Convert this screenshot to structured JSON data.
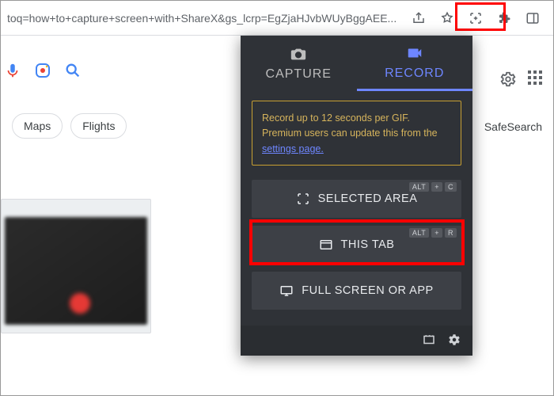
{
  "address_bar": {
    "url_fragment": "toq=how+to+capture+screen+with+ShareX&gs_lcrp=EgZjaHJvbWUyBggAEE..."
  },
  "search": {
    "chips": [
      "Maps",
      "Flights"
    ],
    "safesearch_label": "SafeSearch"
  },
  "popup": {
    "tabs": {
      "capture": "CAPTURE",
      "record": "RECORD"
    },
    "info_text_1": "Record up to 12 seconds per GIF. Premium users can update this from the ",
    "info_link": "settings page.",
    "buttons": {
      "selected_area": "SELECTED AREA",
      "this_tab": "THIS TAB",
      "full_screen": "FULL SCREEN OR APP"
    },
    "shortcuts": {
      "selected_area": [
        "ALT",
        "+",
        "C"
      ],
      "this_tab": [
        "ALT",
        "+",
        "R"
      ]
    }
  }
}
